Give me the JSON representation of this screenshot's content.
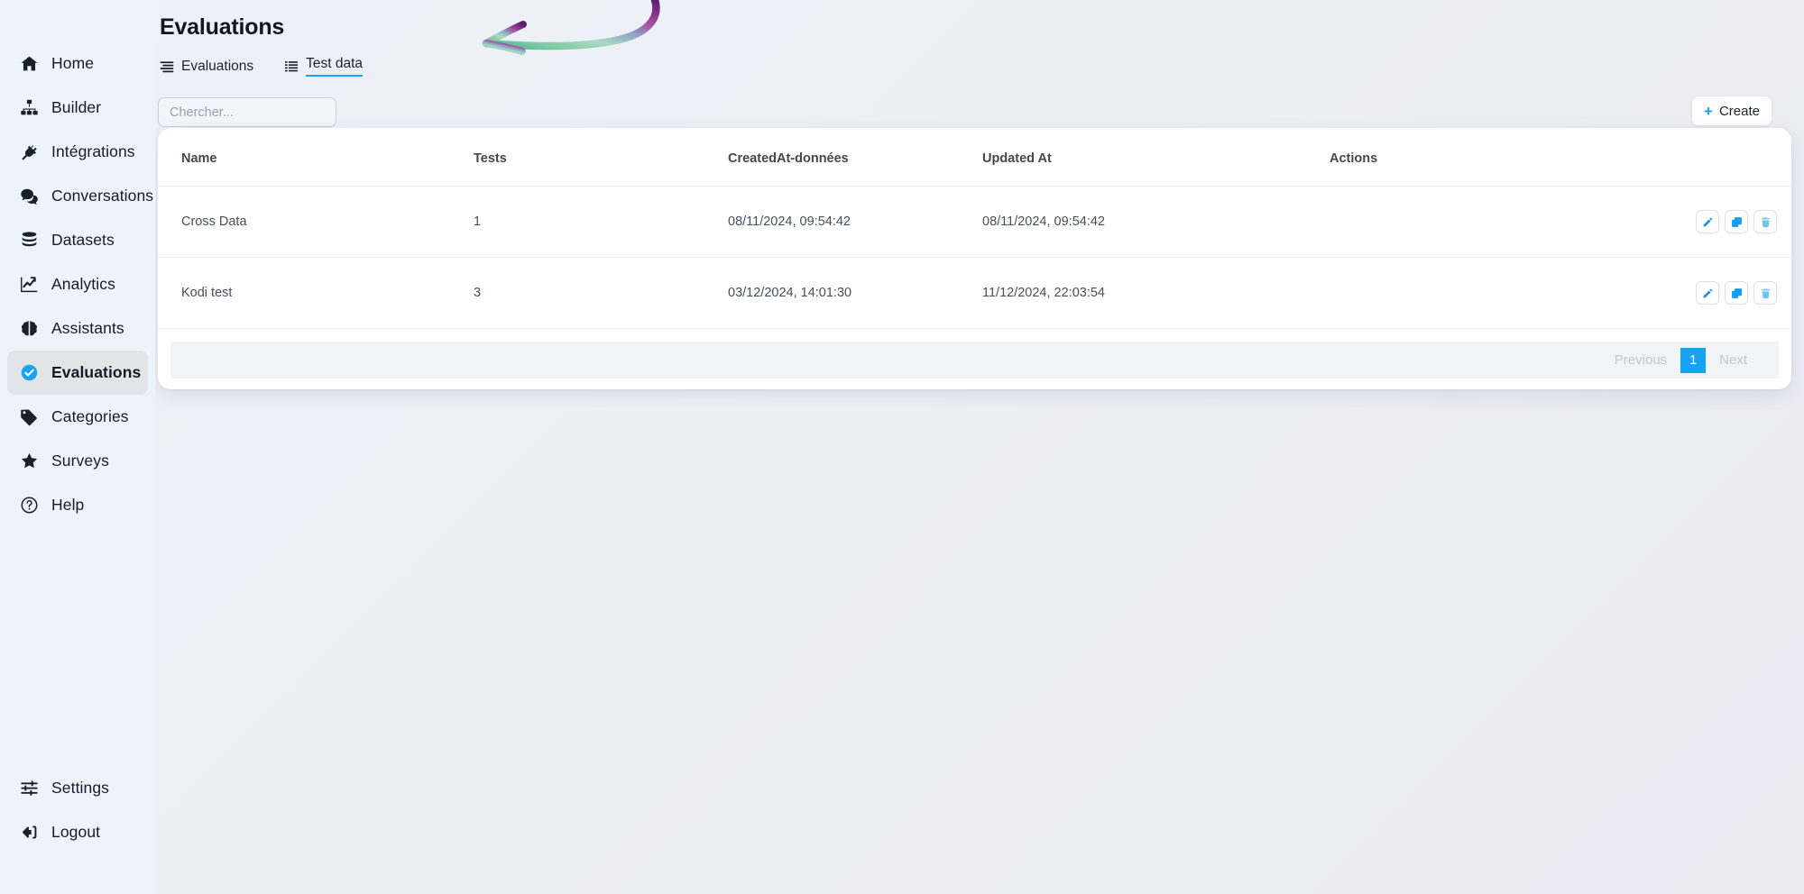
{
  "sidebar": {
    "items": [
      {
        "label": "Home",
        "icon": "home-icon",
        "active": false
      },
      {
        "label": "Builder",
        "icon": "sitemap-icon",
        "active": false
      },
      {
        "label": "Intégrations",
        "icon": "plug-icon",
        "active": false
      },
      {
        "label": "Conversations",
        "icon": "chat-icon",
        "active": false
      },
      {
        "label": "Datasets",
        "icon": "database-icon",
        "active": false
      },
      {
        "label": "Analytics",
        "icon": "chart-line-icon",
        "active": false
      },
      {
        "label": "Assistants",
        "icon": "brain-icon",
        "active": false
      },
      {
        "label": "Evaluations",
        "icon": "check-circle-icon",
        "active": true
      },
      {
        "label": "Categories",
        "icon": "tag-icon",
        "active": false
      },
      {
        "label": "Surveys",
        "icon": "star-icon",
        "active": false
      },
      {
        "label": "Help",
        "icon": "question-circle-icon",
        "active": false
      }
    ],
    "bottom_items": [
      {
        "label": "Settings",
        "icon": "sliders-icon"
      },
      {
        "label": "Logout",
        "icon": "logout-icon"
      }
    ]
  },
  "header": {
    "title": "Evaluations",
    "tabs": [
      {
        "label": "Evaluations",
        "icon": "list-icon",
        "active": false
      },
      {
        "label": "Test data",
        "icon": "list-alt-icon",
        "active": true
      }
    ]
  },
  "toolbar": {
    "search_placeholder": "Chercher...",
    "search_value": "",
    "create_label": "Create",
    "create_icon": "plus-icon"
  },
  "table": {
    "columns": [
      "Name",
      "Tests",
      "CreatedAt-données",
      "Updated At",
      "Actions"
    ],
    "rows": [
      {
        "name": "Cross Data",
        "tests": "1",
        "created_at": "08/11/2024, 09:54:42",
        "updated_at": "08/11/2024, 09:54:42",
        "actions": [
          "edit-icon",
          "duplicate-icon",
          "trash-icon"
        ]
      },
      {
        "name": "Kodi test",
        "tests": "3",
        "created_at": "03/12/2024, 14:01:30",
        "updated_at": "11/12/2024, 22:03:54",
        "actions": [
          "edit-icon",
          "duplicate-icon",
          "trash-icon"
        ]
      }
    ]
  },
  "pagination": {
    "previous_label": "Previous",
    "current_page": "1",
    "next_label": "Next"
  },
  "colors": {
    "accent": "#17a3f5",
    "active_nav_bg": "#e2e4e7",
    "page_bg": "#eeeef6",
    "card_bg": "#ffffff",
    "pagination_bg": "#f1f3f5"
  }
}
